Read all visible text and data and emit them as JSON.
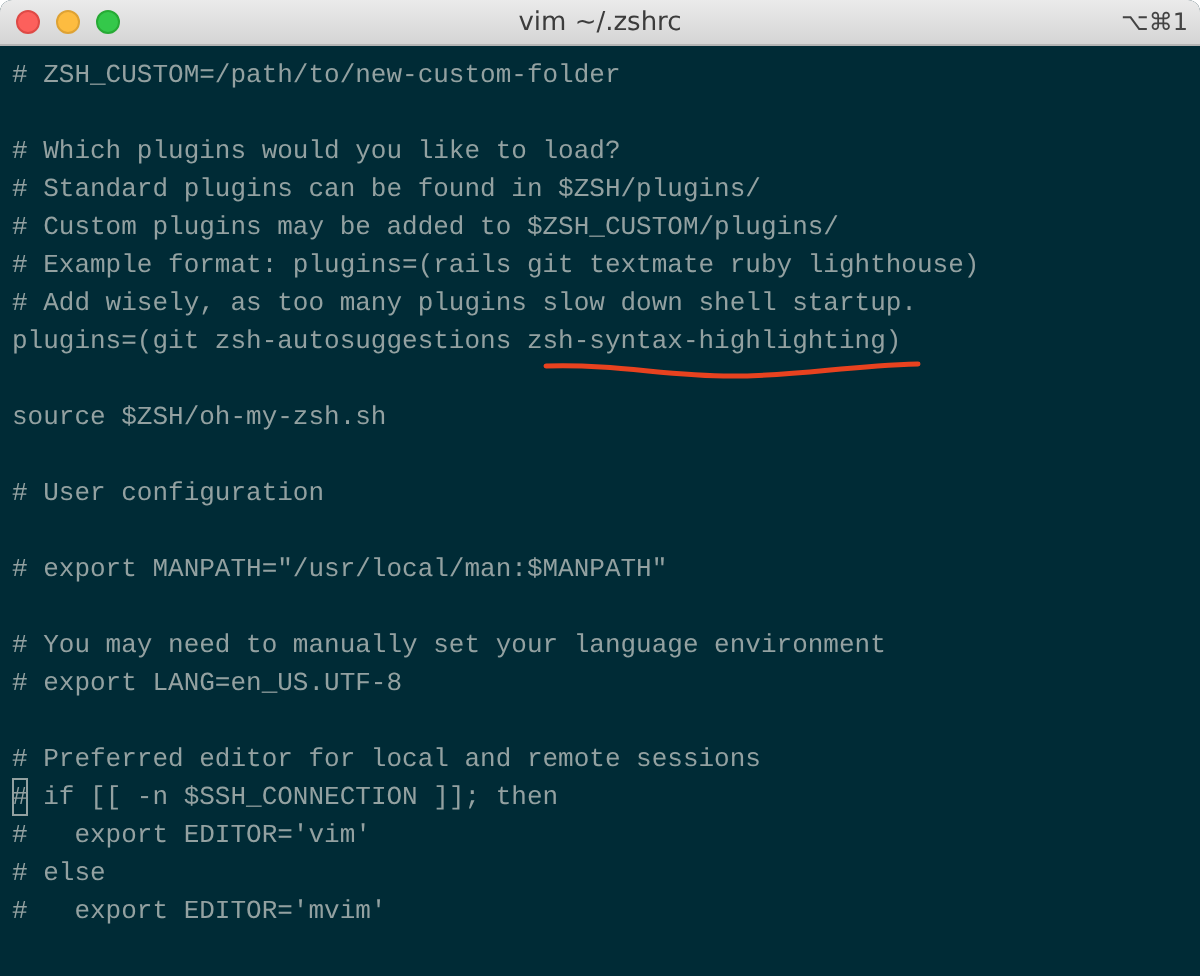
{
  "window": {
    "title": "vim ~/.zshrc",
    "shortcut": "⌥⌘1"
  },
  "lines": [
    {
      "kind": "text",
      "text": "# ZSH_CUSTOM=/path/to/new-custom-folder",
      "cursor": false
    },
    {
      "kind": "blank"
    },
    {
      "kind": "text",
      "text": "# Which plugins would you like to load?",
      "cursor": false
    },
    {
      "kind": "text",
      "text": "# Standard plugins can be found in $ZSH/plugins/",
      "cursor": false
    },
    {
      "kind": "text",
      "text": "# Custom plugins may be added to $ZSH_CUSTOM/plugins/",
      "cursor": false
    },
    {
      "kind": "text",
      "text": "# Example format: plugins=(rails git textmate ruby lighthouse)",
      "cursor": false
    },
    {
      "kind": "text",
      "text": "# Add wisely, as too many plugins slow down shell startup.",
      "cursor": false
    },
    {
      "kind": "text",
      "text": "plugins=(git zsh-autosuggestions zsh-syntax-highlighting)",
      "cursor": false,
      "underline": true
    },
    {
      "kind": "blank"
    },
    {
      "kind": "text",
      "text": "source $ZSH/oh-my-zsh.sh",
      "cursor": false
    },
    {
      "kind": "blank"
    },
    {
      "kind": "text",
      "text": "# User configuration",
      "cursor": false
    },
    {
      "kind": "blank"
    },
    {
      "kind": "text",
      "text": "# export MANPATH=\"/usr/local/man:$MANPATH\"",
      "cursor": false
    },
    {
      "kind": "blank"
    },
    {
      "kind": "text",
      "text": "# You may need to manually set your language environment",
      "cursor": false
    },
    {
      "kind": "text",
      "text": "# export LANG=en_US.UTF-8",
      "cursor": false
    },
    {
      "kind": "blank"
    },
    {
      "kind": "text",
      "text": "# Preferred editor for local and remote sessions",
      "cursor": false
    },
    {
      "kind": "text",
      "text": "# if [[ -n $SSH_CONNECTION ]]; then",
      "cursor": true
    },
    {
      "kind": "text",
      "text": "#   export EDITOR='vim'",
      "cursor": false
    },
    {
      "kind": "text",
      "text": "# else",
      "cursor": false
    },
    {
      "kind": "text",
      "text": "#   export EDITOR='mvim'",
      "cursor": false
    }
  ]
}
